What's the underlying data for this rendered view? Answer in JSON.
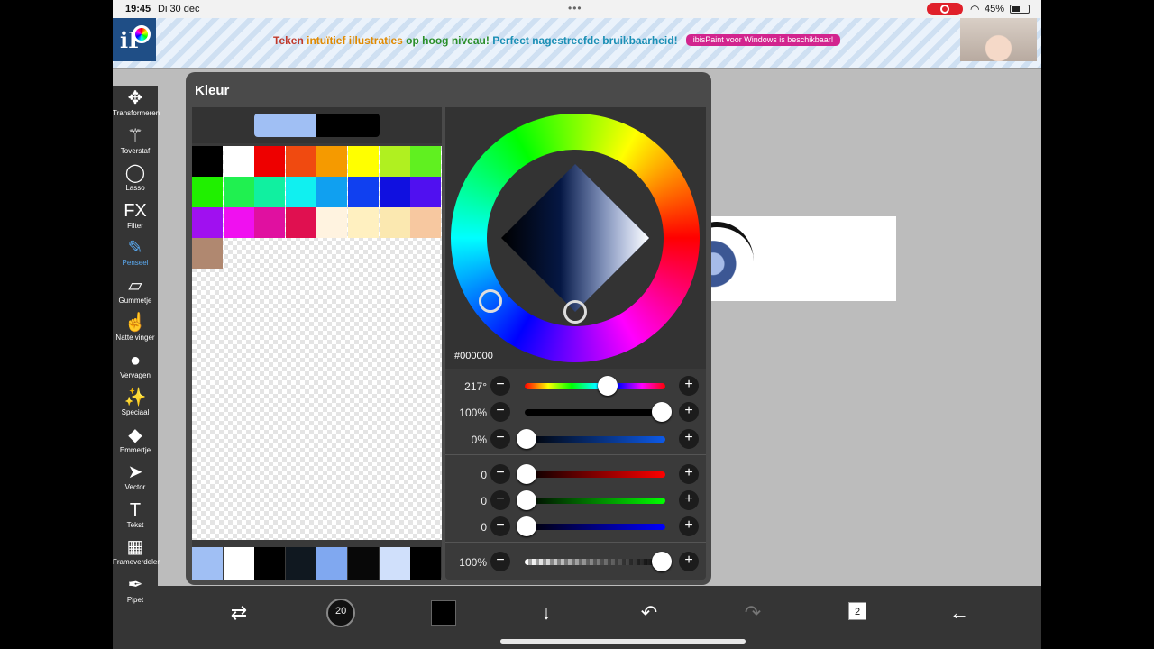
{
  "status": {
    "time": "19:45",
    "date": "Di 30 dec",
    "battery": "45%",
    "wifi_icon": "wifi-icon"
  },
  "banner": {
    "msg1": "Teken",
    "msg2": "intuïtief illustraties",
    "msg3": "op hoog niveau!",
    "msg4": "Perfect nagestreefde bruikbaarheid!",
    "cta": "ibisPaint voor Windows is beschikbaar!",
    "logo_text": "iP"
  },
  "toolbar": {
    "items": [
      {
        "label": "Transformeren",
        "icon": "✥"
      },
      {
        "label": "Toverstaf",
        "icon": "⚚"
      },
      {
        "label": "Lasso",
        "icon": "◯"
      },
      {
        "label": "Filter",
        "icon": "FX"
      },
      {
        "label": "Penseel",
        "icon": "✎"
      },
      {
        "label": "Gummetje",
        "icon": "▱"
      },
      {
        "label": "Natte vinger",
        "icon": "☝"
      },
      {
        "label": "Vervagen",
        "icon": "●"
      },
      {
        "label": "Speciaal",
        "icon": "✨"
      },
      {
        "label": "Emmertje",
        "icon": "◆"
      },
      {
        "label": "Vector",
        "icon": "➤"
      },
      {
        "label": "Tekst",
        "icon": "T"
      },
      {
        "label": "Frameverdeler",
        "icon": "▦"
      },
      {
        "label": "Pipet",
        "icon": "✒"
      }
    ],
    "active": "Penseel"
  },
  "color_panel": {
    "title": "Kleur",
    "current_fg": "#a0bff4",
    "current_bg": "#000000",
    "palette": [
      "#000000",
      "#ffffff",
      "#ee0000",
      "#f04a10",
      "#f59a00",
      "#ffff00",
      "#b0f020",
      "#60f020",
      "#20f000",
      "#20f050",
      "#10f0a0",
      "#10f0f0",
      "#10a0f0",
      "#1040f0",
      "#1010e0",
      "#5010f0",
      "#a010f0",
      "#f010f0",
      "#e010a0",
      "#e01050",
      "#fff3e0",
      "#fff0c0",
      "#fbe8b0",
      "#f7c8a0",
      "#b08870"
    ],
    "recent": [
      "#a0bff4",
      "#ffffff",
      "#000000",
      "#101820",
      "#80a8f0",
      "#080808",
      "#d0e0fb",
      "#000000"
    ],
    "hex": "#000000",
    "hsv": [
      {
        "value": "217°",
        "fraction": 0.6
      },
      {
        "value": "100%",
        "fraction": 1.0
      },
      {
        "value": "0%",
        "fraction": 0.0
      }
    ],
    "rgb": [
      {
        "value": "0",
        "fraction": 0.0
      },
      {
        "value": "0",
        "fraction": 0.0
      },
      {
        "value": "0",
        "fraction": 0.0
      }
    ],
    "opacity": {
      "value": "100%",
      "fraction": 1.0
    },
    "minus": "−",
    "plus": "+"
  },
  "bottom": {
    "brush_size": "20",
    "layers_count": "2"
  }
}
